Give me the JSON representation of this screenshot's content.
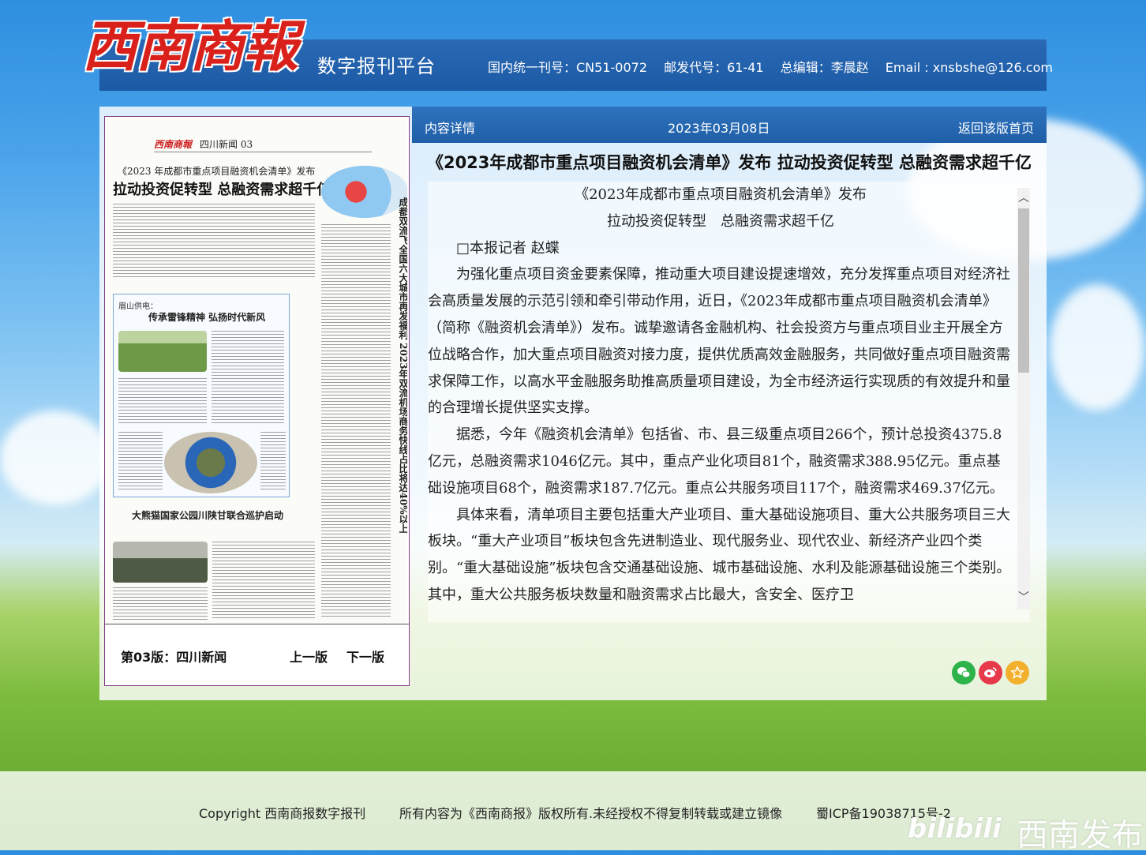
{
  "header": {
    "logo_text": "西南商報",
    "platform_title": "数字报刊平台",
    "cn_label": "国内统一刊号：CN51-0072",
    "postal_label": "邮发代号：61-41",
    "editor_label": "总编辑：李晨赵",
    "email_label": "Email : xnsbshe@126.com"
  },
  "newspaper": {
    "logo": "西南商報",
    "section_header": "四川新闻 03",
    "kicker": "《2023 年成都市重点项目融资机会清单》发布",
    "headline": "拉动投资促转型  总融资需求超千亿",
    "box_kicker": "眉山供电：",
    "box_title": "传承雷锋精神  弘扬时代新风",
    "sub_headline": "大熊猫国家公园川陕甘联合巡护启动",
    "vertical_headline": "成都双流飞全国六大城市再发福利 2023年双流机场商务快线占比将达40%以上"
  },
  "paper_nav": {
    "page_label": "第03版：四川新闻",
    "prev": "上一版",
    "next": "下一版"
  },
  "detail_bar": {
    "label": "内容详情",
    "date": "2023年03月08日",
    "back": "返回该版首页"
  },
  "article": {
    "title": "《2023年成都市重点项目融资机会清单》发布 拉动投资促转型 总融资需求超千亿",
    "line1": "《2023年成都市重点项目融资机会清单》发布",
    "line2": "拉动投资促转型　总融资需求超千亿",
    "byline": "□本报记者  赵蝶",
    "p1": "为强化重点项目资金要素保障，推动重大项目建设提速增效，充分发挥重点项目对经济社会高质量发展的示范引领和牵引带动作用，近日，《2023年成都市重点项目融资机会清单》（简称《融资机会清单》）发布。诚挚邀请各金融机构、社会投资方与重点项目业主开展全方位战略合作，加大重点项目融资对接力度，提供优质高效金融服务，共同做好重点项目融资需求保障工作，以高水平金融服务助推高质量项目建设，为全市经济运行实现质的有效提升和量的合理增长提供坚实支撑。",
    "p2": "据悉，今年《融资机会清单》包括省、市、县三级重点项目266个，预计总投资4375.8亿元，总融资需求1046亿元。其中，重点产业化项目81个，融资需求388.95亿元。重点基础设施项目68个，融资需求187.7亿元。重点公共服务项目117个，融资需求469.37亿元。",
    "p3": "具体来看，清单项目主要包括重大产业项目、重大基础设施项目、重大公共服务项目三大板块。“重大产业项目”板块包含先进制造业、现代服务业、现代农业、新经济产业四个类别。“重大基础设施”板块包含交通基础设施、城市基础设施、水利及能源基础设施三个类别。其中，重大公共服务板块数量和融资需求占比最大，含安全、医疗卫"
  },
  "footer": {
    "copyright": "Copyright 西南商报数字报刊",
    "rights": "所有内容为《西南商报》版权所有.未经授权不得复制转载或建立镜像",
    "icp": "蜀ICP备19038715号-2"
  },
  "watermark": {
    "brand": "bilibili",
    "name": "西南发布"
  },
  "colors": {
    "header_blue": "#1f5fa8",
    "logo_red": "#d9201a",
    "wechat": "#2db34a",
    "weibo": "#e6394a",
    "favorite": "#f2b02c"
  }
}
